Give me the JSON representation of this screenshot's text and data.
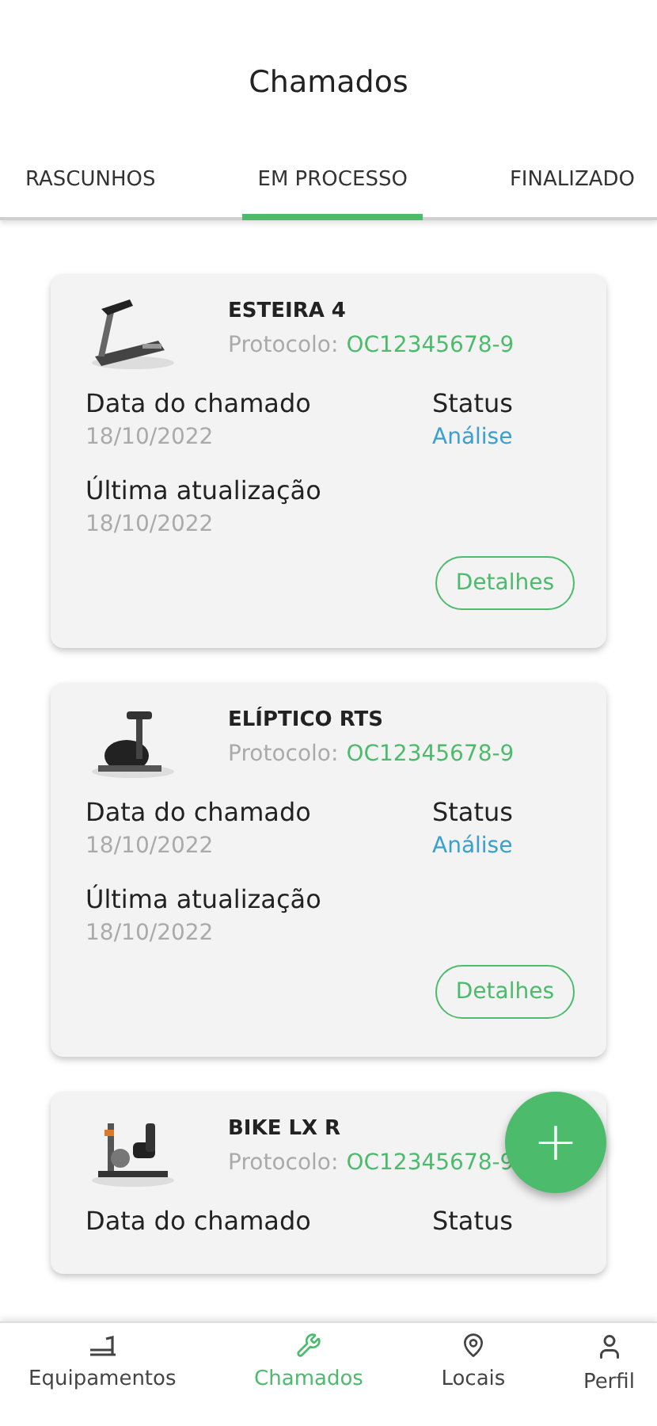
{
  "header": {
    "title": "Chamados"
  },
  "tabs": [
    {
      "label": "RASCUNHOS",
      "selected": false
    },
    {
      "label": "EM PROCESSO",
      "selected": true
    },
    {
      "label": "FINALIZADO",
      "selected": false
    }
  ],
  "cards": [
    {
      "name": "ESTEIRA 4",
      "protocol_label": "Protocolo:",
      "protocol": "OC12345678-9",
      "date_label": "Data do chamado",
      "date": "18/10/2022",
      "status_label": "Status",
      "status": "Análise",
      "updated_label": "Última atualização",
      "updated": "18/10/2022",
      "button": "Detalhes"
    },
    {
      "name": "ELÍPTICO RTS",
      "protocol_label": "Protocolo:",
      "protocol": "OC12345678-9",
      "date_label": "Data do chamado",
      "date": "18/10/2022",
      "status_label": "Status",
      "status": "Análise",
      "updated_label": "Última atualização",
      "updated": "18/10/2022",
      "button": "Detalhes"
    },
    {
      "name": "BIKE LX R",
      "protocol_label": "Protocolo:",
      "protocol": "OC12345678-9",
      "date_label": "Data do chamado",
      "status_label": "Status"
    }
  ],
  "fab": {
    "label": "+"
  },
  "nav": [
    {
      "kind": "equipment",
      "label": "Equipamentos",
      "selected": false
    },
    {
      "kind": "calls",
      "label": "Chamados",
      "selected": true
    },
    {
      "kind": "places",
      "label": "Locais",
      "selected": false
    },
    {
      "kind": "profile",
      "label": "Perfil",
      "selected": false
    }
  ]
}
